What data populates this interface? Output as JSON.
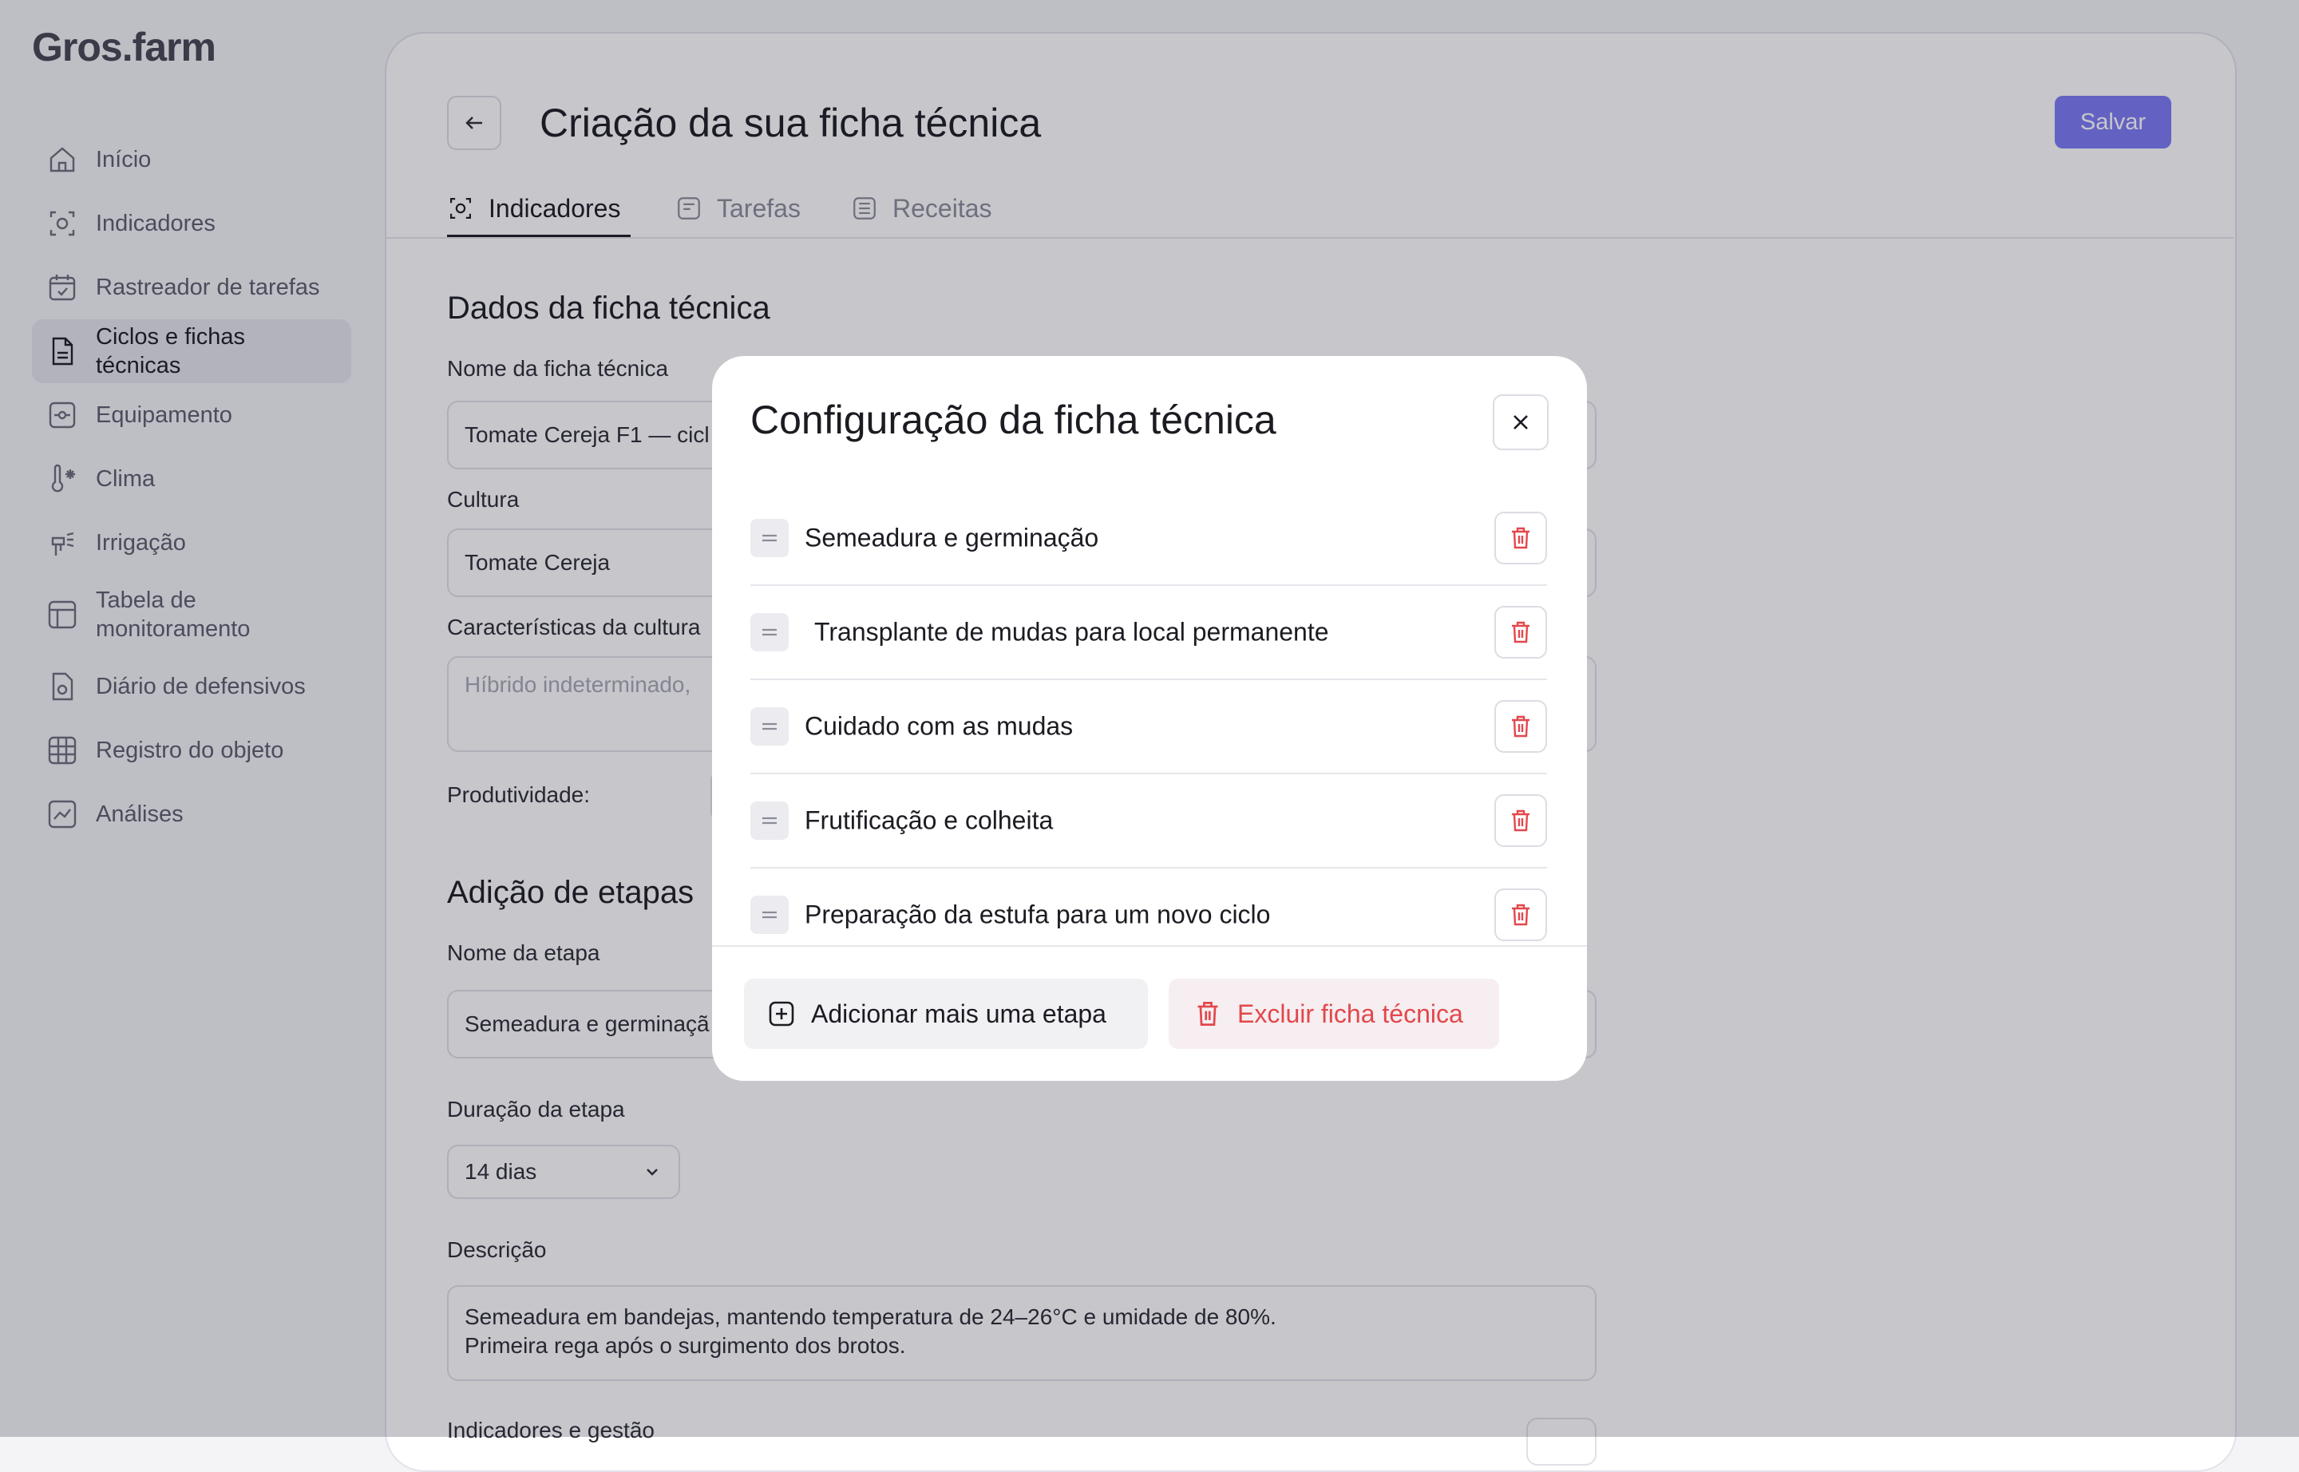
{
  "app": {
    "logo": "Gros.farm"
  },
  "sidebar": {
    "items": [
      {
        "label": "Início",
        "icon": "home-icon"
      },
      {
        "label": "Indicadores",
        "icon": "indicators-icon"
      },
      {
        "label": "Rastreador de tarefas",
        "icon": "calendar-check-icon"
      },
      {
        "label": "Ciclos e fichas técnicas",
        "icon": "document-icon",
        "active": true
      },
      {
        "label": "Equipamento",
        "icon": "equipment-icon"
      },
      {
        "label": "Clima",
        "icon": "thermometer-icon"
      },
      {
        "label": "Irrigação",
        "icon": "irrigation-icon"
      },
      {
        "label": "Tabela de monitoramento",
        "icon": "table-icon"
      },
      {
        "label": "Diário de defensivos",
        "icon": "file-icon"
      },
      {
        "label": "Registro do objeto",
        "icon": "grid-icon"
      },
      {
        "label": "Análises",
        "icon": "chart-icon"
      }
    ]
  },
  "header": {
    "title": "Criação da sua ficha técnica",
    "save_label": "Salvar"
  },
  "tabs": [
    {
      "label": "Indicadores",
      "active": true
    },
    {
      "label": "Tarefas"
    },
    {
      "label": "Receitas"
    }
  ],
  "form": {
    "section1_title": "Dados da ficha técnica",
    "name_label": "Nome da ficha técnica",
    "name_value": "Tomate Cereja F1 — cicl",
    "culture_label": "Cultura",
    "culture_value": "Tomate Cereja",
    "characteristics_label": "Características da cultura",
    "characteristics_placeholder": "Híbrido indeterminado,",
    "productivity_label": "Produtividade:",
    "section2_title": "Adição de etapas",
    "stage_name_label": "Nome da etapa",
    "stage_name_value": "Semeadura e germinaçã",
    "duration_label": "Duração da etapa",
    "duration_value": "14 dias",
    "description_label": "Descrição",
    "description_value": "Semeadura em bandejas, mantendo temperatura de 24–26°C e umidade de 80%. Primeira rega após o surgimento dos brotos.",
    "indicators_label": "Indicadores e gestão"
  },
  "modal": {
    "title": "Configuração da ficha técnica",
    "steps": [
      "Semeadura e germinação",
      "Transplante de mudas para local permanente",
      "Cuidado com as mudas",
      "Frutificação e colheita",
      "Preparação da estufa para um novo ciclo"
    ],
    "add_label": "Adicionar mais uma etapa",
    "delete_label": "Excluir ficha técnica"
  },
  "colors": {
    "accent": "#7b7af5",
    "danger": "#e3474c"
  }
}
